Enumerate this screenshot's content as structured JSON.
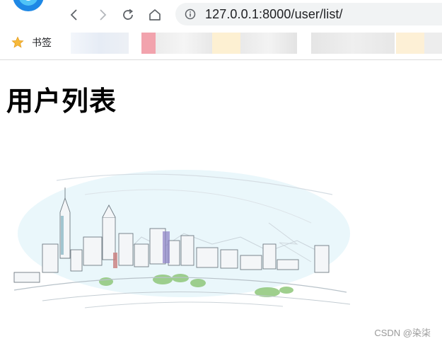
{
  "browser": {
    "address_bar": {
      "url": "127.0.0.1:8000/user/list/"
    },
    "bookmarks_bar": {
      "label": "书签"
    },
    "icons": [
      "browser-logo-icon",
      "back-icon",
      "forward-icon",
      "reload-icon",
      "home-icon",
      "info-icon",
      "star-icon"
    ]
  },
  "page": {
    "title": "用户列表"
  },
  "watermark": "CSDN @染柒"
}
